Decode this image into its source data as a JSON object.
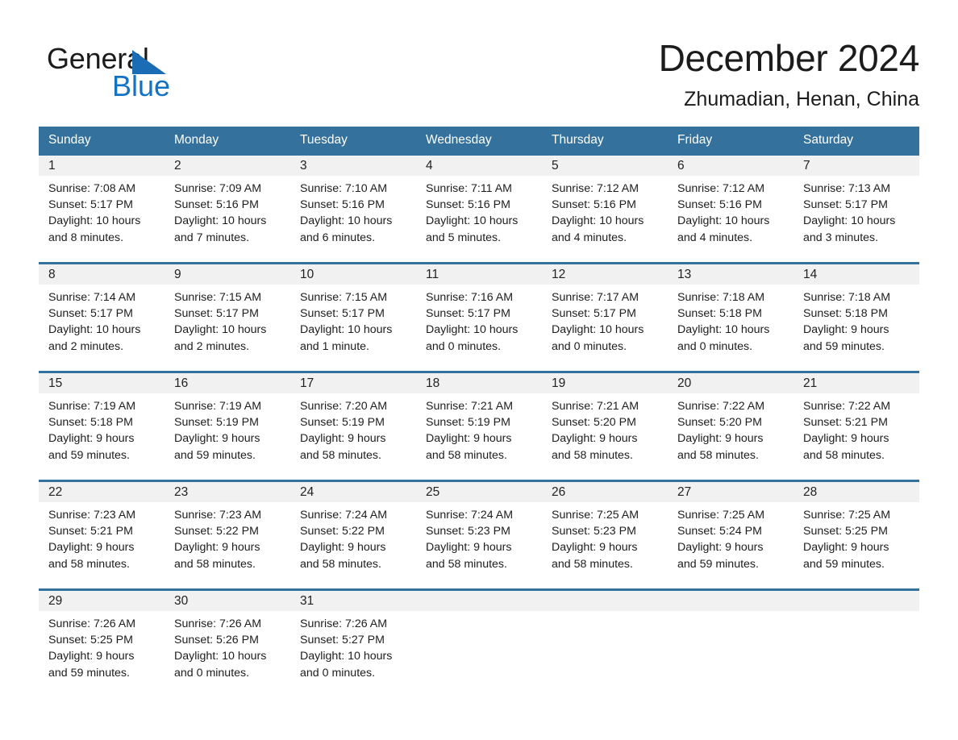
{
  "brand": {
    "logo_line1": "General",
    "logo_line2": "Blue",
    "logo_triangle_color": "#1a6cb4",
    "logo_blue_color": "#1272c4"
  },
  "header": {
    "title": "December 2024",
    "subtitle": "Zhumadian, Henan, China"
  },
  "theme": {
    "header_bg": "#34719c",
    "daynum_band": "#f1f1f1",
    "page_bg": "#ffffff",
    "text": "#1d1d1d"
  },
  "weekdays": [
    "Sunday",
    "Monday",
    "Tuesday",
    "Wednesday",
    "Thursday",
    "Friday",
    "Saturday"
  ],
  "weeks": [
    [
      {
        "day": "1",
        "info": "Sunrise: 7:08 AM\nSunset: 5:17 PM\nDaylight: 10 hours\nand 8 minutes."
      },
      {
        "day": "2",
        "info": "Sunrise: 7:09 AM\nSunset: 5:16 PM\nDaylight: 10 hours\nand 7 minutes."
      },
      {
        "day": "3",
        "info": "Sunrise: 7:10 AM\nSunset: 5:16 PM\nDaylight: 10 hours\nand 6 minutes."
      },
      {
        "day": "4",
        "info": "Sunrise: 7:11 AM\nSunset: 5:16 PM\nDaylight: 10 hours\nand 5 minutes."
      },
      {
        "day": "5",
        "info": "Sunrise: 7:12 AM\nSunset: 5:16 PM\nDaylight: 10 hours\nand 4 minutes."
      },
      {
        "day": "6",
        "info": "Sunrise: 7:12 AM\nSunset: 5:16 PM\nDaylight: 10 hours\nand 4 minutes."
      },
      {
        "day": "7",
        "info": "Sunrise: 7:13 AM\nSunset: 5:17 PM\nDaylight: 10 hours\nand 3 minutes."
      }
    ],
    [
      {
        "day": "8",
        "info": "Sunrise: 7:14 AM\nSunset: 5:17 PM\nDaylight: 10 hours\nand 2 minutes."
      },
      {
        "day": "9",
        "info": "Sunrise: 7:15 AM\nSunset: 5:17 PM\nDaylight: 10 hours\nand 2 minutes."
      },
      {
        "day": "10",
        "info": "Sunrise: 7:15 AM\nSunset: 5:17 PM\nDaylight: 10 hours\nand 1 minute."
      },
      {
        "day": "11",
        "info": "Sunrise: 7:16 AM\nSunset: 5:17 PM\nDaylight: 10 hours\nand 0 minutes."
      },
      {
        "day": "12",
        "info": "Sunrise: 7:17 AM\nSunset: 5:17 PM\nDaylight: 10 hours\nand 0 minutes."
      },
      {
        "day": "13",
        "info": "Sunrise: 7:18 AM\nSunset: 5:18 PM\nDaylight: 10 hours\nand 0 minutes."
      },
      {
        "day": "14",
        "info": "Sunrise: 7:18 AM\nSunset: 5:18 PM\nDaylight: 9 hours\nand 59 minutes."
      }
    ],
    [
      {
        "day": "15",
        "info": "Sunrise: 7:19 AM\nSunset: 5:18 PM\nDaylight: 9 hours\nand 59 minutes."
      },
      {
        "day": "16",
        "info": "Sunrise: 7:19 AM\nSunset: 5:19 PM\nDaylight: 9 hours\nand 59 minutes."
      },
      {
        "day": "17",
        "info": "Sunrise: 7:20 AM\nSunset: 5:19 PM\nDaylight: 9 hours\nand 58 minutes."
      },
      {
        "day": "18",
        "info": "Sunrise: 7:21 AM\nSunset: 5:19 PM\nDaylight: 9 hours\nand 58 minutes."
      },
      {
        "day": "19",
        "info": "Sunrise: 7:21 AM\nSunset: 5:20 PM\nDaylight: 9 hours\nand 58 minutes."
      },
      {
        "day": "20",
        "info": "Sunrise: 7:22 AM\nSunset: 5:20 PM\nDaylight: 9 hours\nand 58 minutes."
      },
      {
        "day": "21",
        "info": "Sunrise: 7:22 AM\nSunset: 5:21 PM\nDaylight: 9 hours\nand 58 minutes."
      }
    ],
    [
      {
        "day": "22",
        "info": "Sunrise: 7:23 AM\nSunset: 5:21 PM\nDaylight: 9 hours\nand 58 minutes."
      },
      {
        "day": "23",
        "info": "Sunrise: 7:23 AM\nSunset: 5:22 PM\nDaylight: 9 hours\nand 58 minutes."
      },
      {
        "day": "24",
        "info": "Sunrise: 7:24 AM\nSunset: 5:22 PM\nDaylight: 9 hours\nand 58 minutes."
      },
      {
        "day": "25",
        "info": "Sunrise: 7:24 AM\nSunset: 5:23 PM\nDaylight: 9 hours\nand 58 minutes."
      },
      {
        "day": "26",
        "info": "Sunrise: 7:25 AM\nSunset: 5:23 PM\nDaylight: 9 hours\nand 58 minutes."
      },
      {
        "day": "27",
        "info": "Sunrise: 7:25 AM\nSunset: 5:24 PM\nDaylight: 9 hours\nand 59 minutes."
      },
      {
        "day": "28",
        "info": "Sunrise: 7:25 AM\nSunset: 5:25 PM\nDaylight: 9 hours\nand 59 minutes."
      }
    ],
    [
      {
        "day": "29",
        "info": "Sunrise: 7:26 AM\nSunset: 5:25 PM\nDaylight: 9 hours\nand 59 minutes."
      },
      {
        "day": "30",
        "info": "Sunrise: 7:26 AM\nSunset: 5:26 PM\nDaylight: 10 hours\nand 0 minutes."
      },
      {
        "day": "31",
        "info": "Sunrise: 7:26 AM\nSunset: 5:27 PM\nDaylight: 10 hours\nand 0 minutes."
      },
      {
        "day": "",
        "info": ""
      },
      {
        "day": "",
        "info": ""
      },
      {
        "day": "",
        "info": ""
      },
      {
        "day": "",
        "info": ""
      }
    ]
  ]
}
